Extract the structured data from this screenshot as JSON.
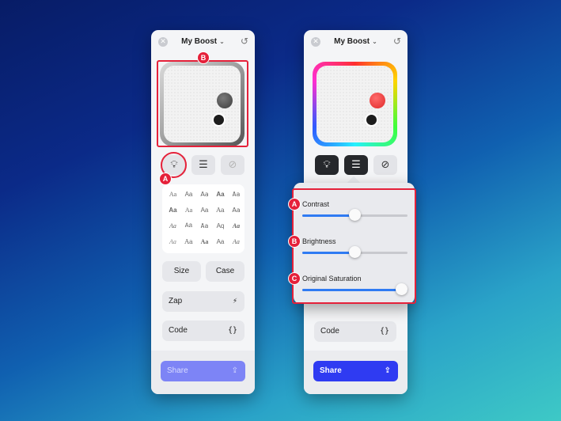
{
  "left_panel": {
    "title": "My Boost",
    "close_glyph": "✕",
    "chevron_glyph": "⌄",
    "undo_glyph": "↺",
    "tools": [
      {
        "name": "lightbulb-icon",
        "glyph": "💡︎"
      },
      {
        "name": "sliders-icon",
        "glyph": "☰"
      },
      {
        "name": "no-symbol-icon",
        "glyph": "⊘"
      }
    ],
    "font_samples": [
      "Aa",
      "Aa",
      "Aa",
      "Aa",
      "Aa",
      "Aa",
      "Aa",
      "Aa",
      "Aa",
      "Aa",
      "Aa",
      "Aa",
      "Aa",
      "Aq",
      "Aa",
      "Aa",
      "Aa",
      "Aa",
      "Aa",
      "Aa"
    ],
    "size_label": "Size",
    "case_label": "Case",
    "zap_label": "Zap",
    "zap_glyph": "⚡",
    "code_label": "Code",
    "code_glyph": "{}",
    "share_label": "Share",
    "share_glyph": "⇪"
  },
  "right_panel": {
    "title": "My Boost",
    "close_glyph": "✕",
    "chevron_glyph": "⌄",
    "undo_glyph": "↺",
    "tools": [
      {
        "name": "lightbulb-icon",
        "glyph": "💡︎"
      },
      {
        "name": "sliders-icon",
        "glyph": "☰"
      },
      {
        "name": "no-symbol-icon",
        "glyph": "⊘"
      }
    ],
    "code_label": "Code",
    "code_glyph": "{}",
    "share_label": "Share",
    "share_glyph": "⇪"
  },
  "sliders": [
    {
      "label": "Contrast",
      "value": 0.5
    },
    {
      "label": "Brightness",
      "value": 0.5
    },
    {
      "label": "Original Saturation",
      "value": 1.0
    }
  ],
  "annotations": {
    "left_a": "A",
    "left_b": "B",
    "slider_a": "A",
    "slider_b": "B",
    "slider_c": "C"
  },
  "colors": {
    "accent": "#2f3bf2",
    "annotation": "#e5213a",
    "slider_fill": "#2f7bf3"
  }
}
